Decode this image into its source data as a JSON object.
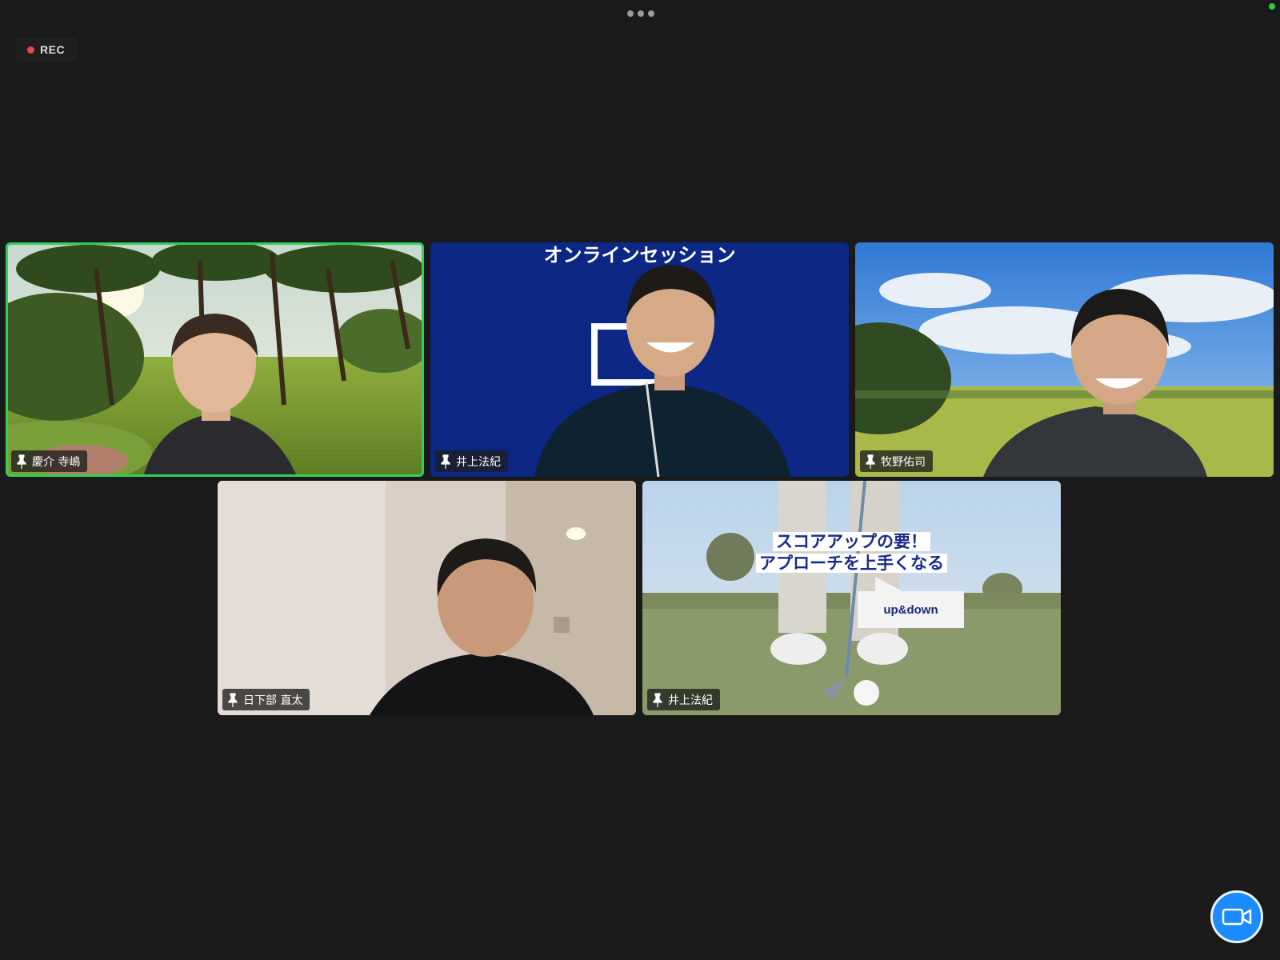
{
  "toolbar": {
    "more_icon": "more-dots-icon"
  },
  "recording": {
    "label": "REC",
    "color": "#e5484d"
  },
  "participants": [
    {
      "name": "慶介 寺嶋",
      "active_speaker": true,
      "border_color": "#2fd15a"
    },
    {
      "name": "井上法紀",
      "background_text": "オンラインセッション"
    },
    {
      "name": "牧野佑司"
    },
    {
      "name": "日下部 直太"
    },
    {
      "name": "井上法紀",
      "overlay_line1": "スコアアップの要！",
      "overlay_line2": "アプローチを上手くなる",
      "callout": "up&down"
    }
  ],
  "controls": {
    "video_button_icon": "video-camera-icon",
    "accent": "#1a8cff"
  }
}
